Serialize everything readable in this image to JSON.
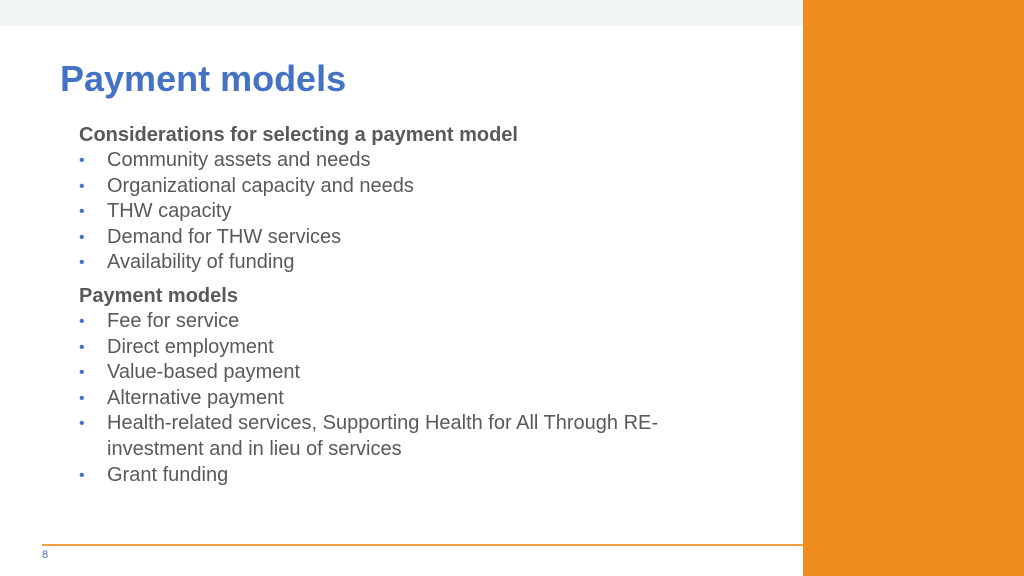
{
  "slide": {
    "title": "Payment models",
    "page_number": "8",
    "colors": {
      "title": "#4472c4",
      "accent_panel": "#ee8c1d",
      "body_text": "#595959",
      "bullet": "#4472c4",
      "footer_line": "#eda044"
    }
  },
  "sections": [
    {
      "heading": "Considerations for selecting a payment model",
      "items": [
        "Community assets and needs",
        "Organizational capacity and needs",
        "THW capacity",
        "Demand for THW services",
        "Availability of funding"
      ]
    },
    {
      "heading": "Payment models",
      "items": [
        "Fee for service",
        "Direct employment",
        "Value-based payment",
        "Alternative payment",
        "Health-related services, Supporting Health for All Through RE-investment and in lieu of services",
        "Grant funding"
      ]
    }
  ],
  "bullet_glyph": "•"
}
